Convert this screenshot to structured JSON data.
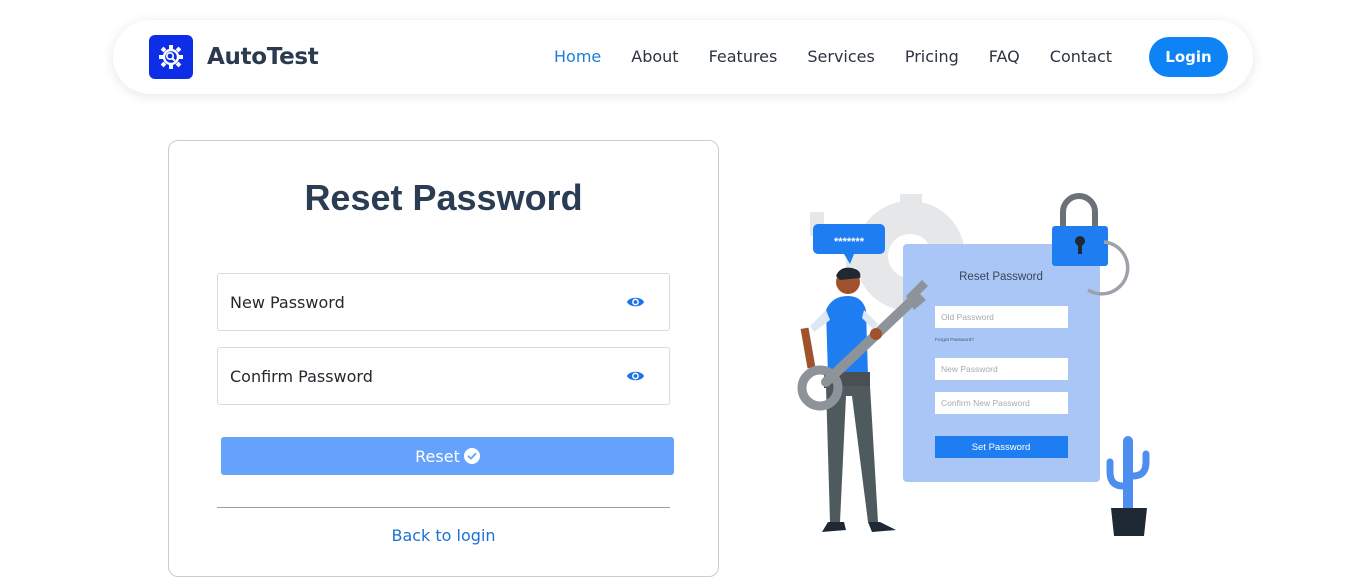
{
  "brand": {
    "name": "AutoTest",
    "logo_icon": "gear-magnifier-icon",
    "logo_color": "#0d2ee6"
  },
  "nav": {
    "links": [
      "Home",
      "About",
      "Features",
      "Services",
      "Pricing",
      "FAQ",
      "Contact"
    ],
    "active": "Home",
    "login_label": "Login",
    "accent_color": "#0d83f5"
  },
  "form": {
    "title": "Reset Password",
    "new_password_placeholder": "New Password",
    "confirm_password_placeholder": "Confirm Password",
    "reset_label": "Reset",
    "back_label": "Back to login",
    "button_color": "#64a2fb"
  },
  "illustration": {
    "speech_bubble": "*******",
    "card_title": "Reset Password",
    "old_password": "Old Password",
    "forgot_password": "Forgot Password?",
    "new_password": "New Password",
    "confirm_new_password": "Confirm New Password",
    "set_password": "Set Password"
  }
}
